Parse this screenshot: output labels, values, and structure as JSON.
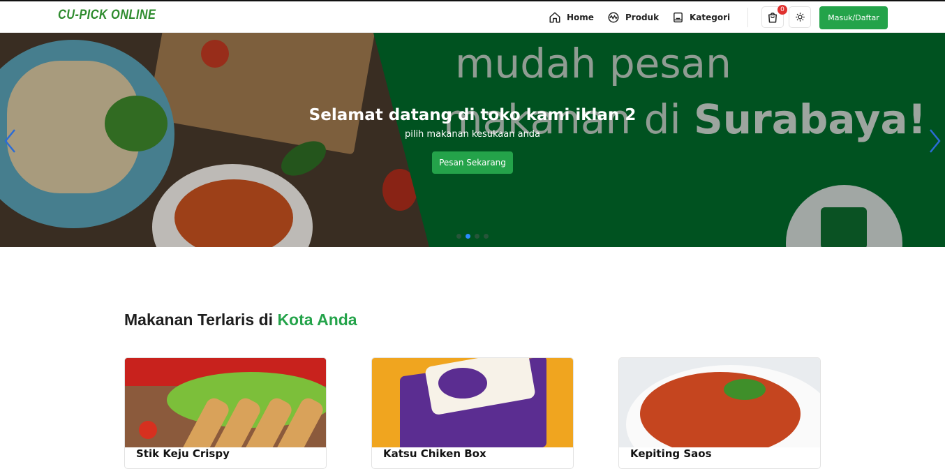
{
  "navbar": {
    "brand": "CU-PICK ONLINE",
    "items": [
      {
        "label": "Home",
        "icon": "home-icon"
      },
      {
        "label": "Produk",
        "icon": "product-icon"
      },
      {
        "label": "Kategori",
        "icon": "book-icon"
      }
    ],
    "cart_count": "0",
    "theme_icon": "sun-icon",
    "login_label": "Masuk/Daftar"
  },
  "hero": {
    "title": "Selamat datang di toko kami iklan 2",
    "subtitle": "pilih makanan kesukaan anda",
    "cta_label": "Pesan Sekarang",
    "ad_line1": "mudah pesan",
    "ad_line2_prefix": "makanan di ",
    "ad_line2_bold": "Surabaya!",
    "slides": 4,
    "active_slide": 2,
    "accent_color": "#24a34a"
  },
  "section": {
    "title_prefix": "Makanan Terlaris di ",
    "title_accent": "Kota Anda"
  },
  "products": [
    {
      "name": "Stik Keju Crispy"
    },
    {
      "name": "Katsu Chiken Box"
    },
    {
      "name": "Kepiting Saos"
    }
  ],
  "colors": {
    "brand_green": "#2e8b2e",
    "button_green": "#24a34a",
    "badge_red": "#e0312f",
    "arrow_blue": "#2b6cd6"
  }
}
